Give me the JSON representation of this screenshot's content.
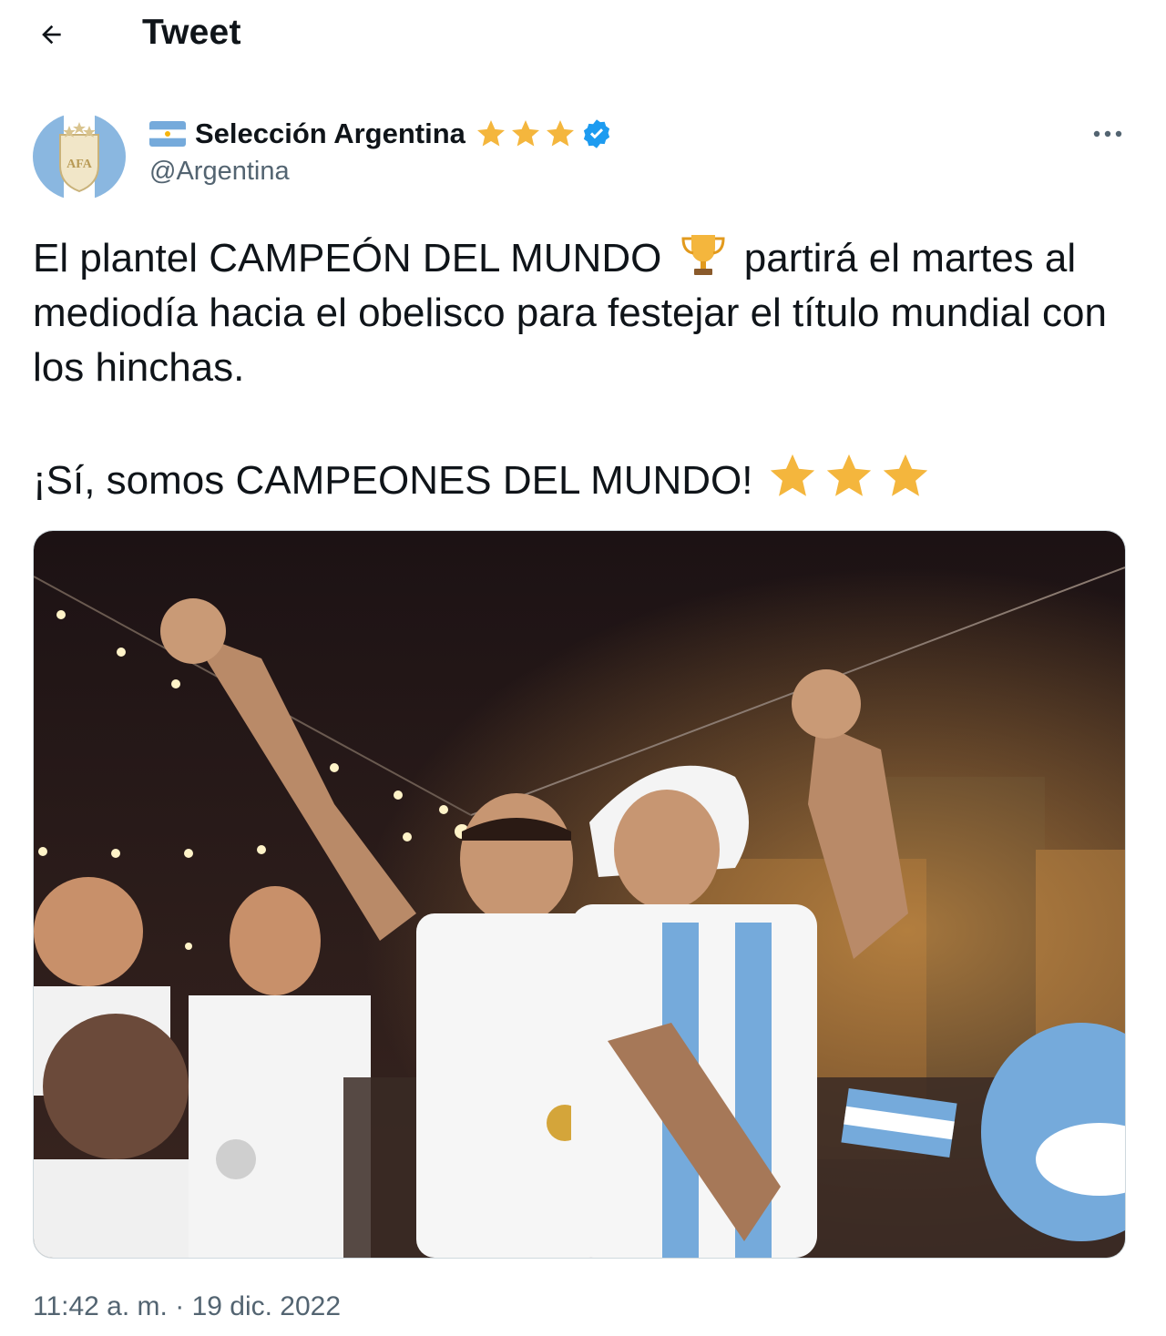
{
  "header": {
    "title": "Tweet",
    "back_icon": "arrow-left-icon"
  },
  "author": {
    "display_name": "Selección Argentina",
    "handle": "@Argentina",
    "badge_stars": "★★★",
    "verified": true,
    "flag_icon": "argentina-flag-icon",
    "avatar_text": "AFA"
  },
  "tweet": {
    "line1_before": "El plantel CAMPEÓN DEL MUNDO",
    "trophy_icon": "trophy-icon",
    "line1_after": "partirá el martes al mediodía hacia el obelisco para festejar el título mundial con los hinchas.",
    "paragraph2": "¡Sí, somos CAMPEONES DEL MUNDO!",
    "star_emoji_count": 3
  },
  "media": {
    "type": "photo",
    "description_icon": "photo-image"
  },
  "meta": {
    "time": "11:42 a. m.",
    "separator": "·",
    "date": "19 dic. 2022"
  },
  "colors": {
    "text": "#0f1419",
    "secondary": "#536471",
    "verified_blue": "#1d9bf0",
    "star_gold": "#f4b63d",
    "sky_blue": "#75aadb"
  }
}
